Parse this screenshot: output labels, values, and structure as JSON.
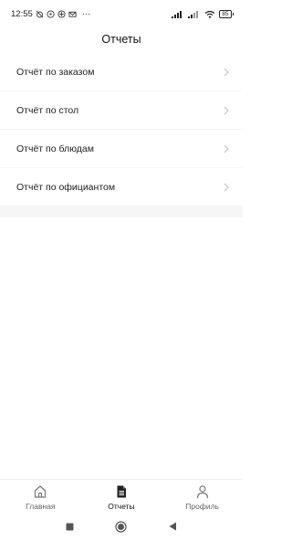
{
  "status_bar": {
    "time": "12:55",
    "more": "···",
    "battery": "85"
  },
  "header": {
    "title": "Отчеты"
  },
  "reports": [
    {
      "label": "Отчёт по заказом"
    },
    {
      "label": "Отчёт по стол"
    },
    {
      "label": "Отчёт по блюдам"
    },
    {
      "label": "Отчёт по официантом"
    }
  ],
  "bottom_nav": [
    {
      "label": "Главная",
      "icon": "home-icon",
      "active": false
    },
    {
      "label": "Отчеты",
      "icon": "document-icon",
      "active": true
    },
    {
      "label": "Профиль",
      "icon": "person-icon",
      "active": false
    }
  ],
  "system_nav": [
    "recents-square-icon",
    "home-circle-icon",
    "back-triangle-icon"
  ]
}
